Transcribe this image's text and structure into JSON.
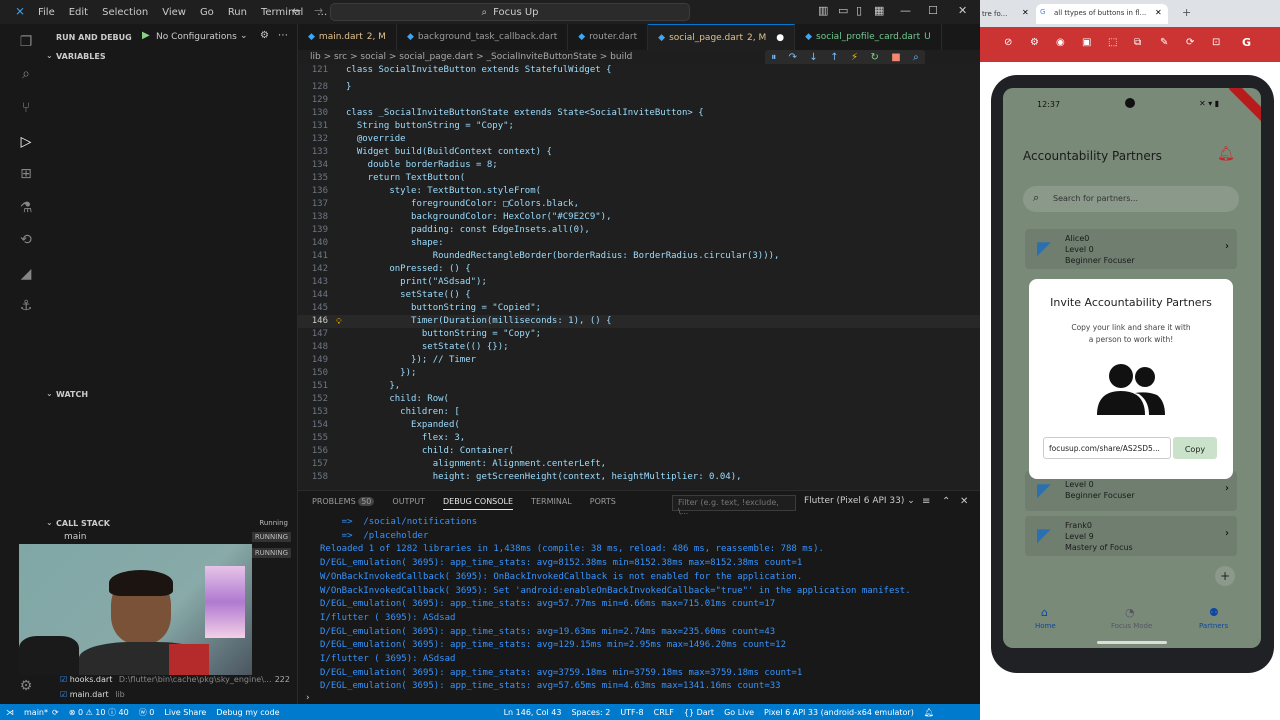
{
  "titlebar": {
    "menu": [
      "File",
      "Edit",
      "Selection",
      "View",
      "Go",
      "Run",
      "Terminal",
      "…"
    ],
    "search": "Focus Up"
  },
  "sidebar": {
    "run_and_debug": "RUN AND DEBUG",
    "config": "No Configurations",
    "variables": "VARIABLES",
    "watch": "WATCH",
    "call_stack": "CALL STACK",
    "call_stack_status": "Running",
    "main_label": "main",
    "running": "RUNNING",
    "breakpoints": [
      {
        "file": "hooks.dart",
        "path": "D:\\flutter\\bin\\cache\\pkg\\sky_engine\\...",
        "count": "222"
      },
      {
        "file": "main.dart",
        "path": "lib",
        "count": ""
      }
    ]
  },
  "tabs": [
    {
      "label": "main.dart",
      "mod": "2, M",
      "active": false
    },
    {
      "label": "background_task_callback.dart",
      "mod": "",
      "active": false
    },
    {
      "label": "router.dart",
      "mod": "",
      "active": false
    },
    {
      "label": "social_page.dart",
      "mod": "2, M",
      "active": true
    },
    {
      "label": "social_profile_card.dart",
      "mod": "U",
      "active": false
    }
  ],
  "breadcrumb": "lib > src > social > social_page.dart > _SocialInviteButtonState > build",
  "editor": {
    "lines": [
      {
        "n": "121",
        "t": "class SocialInviteButton extends StatefulWidget {"
      },
      {
        "n": "128",
        "t": "}"
      },
      {
        "n": "129",
        "t": ""
      },
      {
        "n": "130",
        "t": "class _SocialInviteButtonState extends State<SocialInviteButton> {"
      },
      {
        "n": "131",
        "t": "  String buttonString = \"Copy\";"
      },
      {
        "n": "132",
        "t": "  @override"
      },
      {
        "n": "133",
        "t": "  Widget build(BuildContext context) {"
      },
      {
        "n": "134",
        "t": "    double borderRadius = 8;"
      },
      {
        "n": "135",
        "t": "    return TextButton("
      },
      {
        "n": "136",
        "t": "        style: TextButton.styleFrom("
      },
      {
        "n": "137",
        "t": "            foregroundColor: □Colors.black,"
      },
      {
        "n": "138",
        "t": "            backgroundColor: HexColor(\"#C9E2C9\"),"
      },
      {
        "n": "139",
        "t": "            padding: const EdgeInsets.all(0),"
      },
      {
        "n": "140",
        "t": "            shape:"
      },
      {
        "n": "141",
        "t": "                RoundedRectangleBorder(borderRadius: BorderRadius.circular(3))),"
      },
      {
        "n": "142",
        "t": "        onPressed: () {"
      },
      {
        "n": "143",
        "t": "          print(\"ASdsad\");"
      },
      {
        "n": "144",
        "t": "          setState(() {"
      },
      {
        "n": "145",
        "t": "            buttonString = \"Copied\";"
      },
      {
        "n": "146",
        "t": "            Timer(Duration(milliseconds: 1), () {"
      },
      {
        "n": "147",
        "t": "              buttonString = \"Copy\";"
      },
      {
        "n": "148",
        "t": "              setState(() {});"
      },
      {
        "n": "149",
        "t": "            }); // Timer"
      },
      {
        "n": "150",
        "t": "          });"
      },
      {
        "n": "151",
        "t": "        },"
      },
      {
        "n": "152",
        "t": "        child: Row("
      },
      {
        "n": "153",
        "t": "          children: ["
      },
      {
        "n": "154",
        "t": "            Expanded("
      },
      {
        "n": "155",
        "t": "              flex: 3,"
      },
      {
        "n": "156",
        "t": "              child: Container("
      },
      {
        "n": "157",
        "t": "                alignment: Alignment.centerLeft,"
      },
      {
        "n": "158",
        "t": "                height: getScreenHeight(context, heightMultiplier: 0.04),"
      }
    ],
    "current_line": "146"
  },
  "panel": {
    "tabs": [
      "PROBLEMS",
      "OUTPUT",
      "DEBUG CONSOLE",
      "TERMINAL",
      "PORTS"
    ],
    "problems_count": "50",
    "filter_placeholder": "Filter (e.g. text, !exclude, \\...",
    "device": "Flutter (Pixel 6 API 33)",
    "console": [
      "    =>  /social/notifications",
      "    =>  /placeholder",
      "Reloaded 1 of 1282 libraries in 1,438ms (compile: 38 ms, reload: 486 ms, reassemble: 788 ms).",
      "D/EGL_emulation( 3695): app_time_stats: avg=8152.38ms min=8152.38ms max=8152.38ms count=1",
      "W/OnBackInvokedCallback( 3695): OnBackInvokedCallback is not enabled for the application.",
      "W/OnBackInvokedCallback( 3695): Set 'android:enableOnBackInvokedCallback=\"true\"' in the application manifest.",
      "D/EGL_emulation( 3695): app_time_stats: avg=57.77ms min=6.66ms max=715.01ms count=17",
      "I/flutter ( 3695): ASdsad",
      "D/EGL_emulation( 3695): app_time_stats: avg=19.63ms min=2.74ms max=235.60ms count=43",
      "D/EGL_emulation( 3695): app_time_stats: avg=129.15ms min=2.95ms max=1496.20ms count=12",
      "I/flutter ( 3695): ASdsad",
      "D/EGL_emulation( 3695): app_time_stats: avg=3759.18ms min=3759.18ms max=3759.18ms count=1",
      "D/EGL_emulation( 3695): app_time_stats: avg=57.65ms min=4.63ms max=1341.16ms count=33"
    ]
  },
  "statusbar": {
    "branch": "main*",
    "errors": "⊗ 0 ⚠ 10 ⓘ 40",
    "ports": "ⓦ 0",
    "live_share": "Live Share",
    "debug": "Debug my code",
    "position": "Ln 146, Col 43",
    "spaces": "Spaces: 2",
    "encoding": "UTF-8",
    "eol": "CRLF",
    "lang": "{} Dart",
    "golive": "Go Live",
    "device": "Pixel 6 API 33 (android-x64 emulator)"
  },
  "browser": {
    "tab1": "tre fo...",
    "tab2": "all ttypes of buttons in fl..."
  },
  "phone": {
    "time": "12:37",
    "app_title": "Accountability Partners",
    "search_placeholder": "Search for partners...",
    "partners": [
      {
        "name": "Alice0",
        "level": "Level 0",
        "rank": "Beginner Focuser"
      },
      {
        "name": "",
        "level": "Level 0",
        "rank": "Beginner Focuser"
      },
      {
        "name": "Frank0",
        "level": "Level 9",
        "rank": "Mastery of Focus"
      }
    ],
    "dialog": {
      "title": "Invite Accountability Partners",
      "desc1": "Copy your link and share it with",
      "desc2": "a person to work with!",
      "link": "focusup.com/share/AS2SD5...",
      "copy": "Copy"
    },
    "nav": [
      "Home",
      "Focus Mode",
      "Partners"
    ]
  },
  "colors": {
    "accent": "#007acc",
    "dialog_button": "#C9E2C9",
    "notification": "#d32f2f"
  }
}
